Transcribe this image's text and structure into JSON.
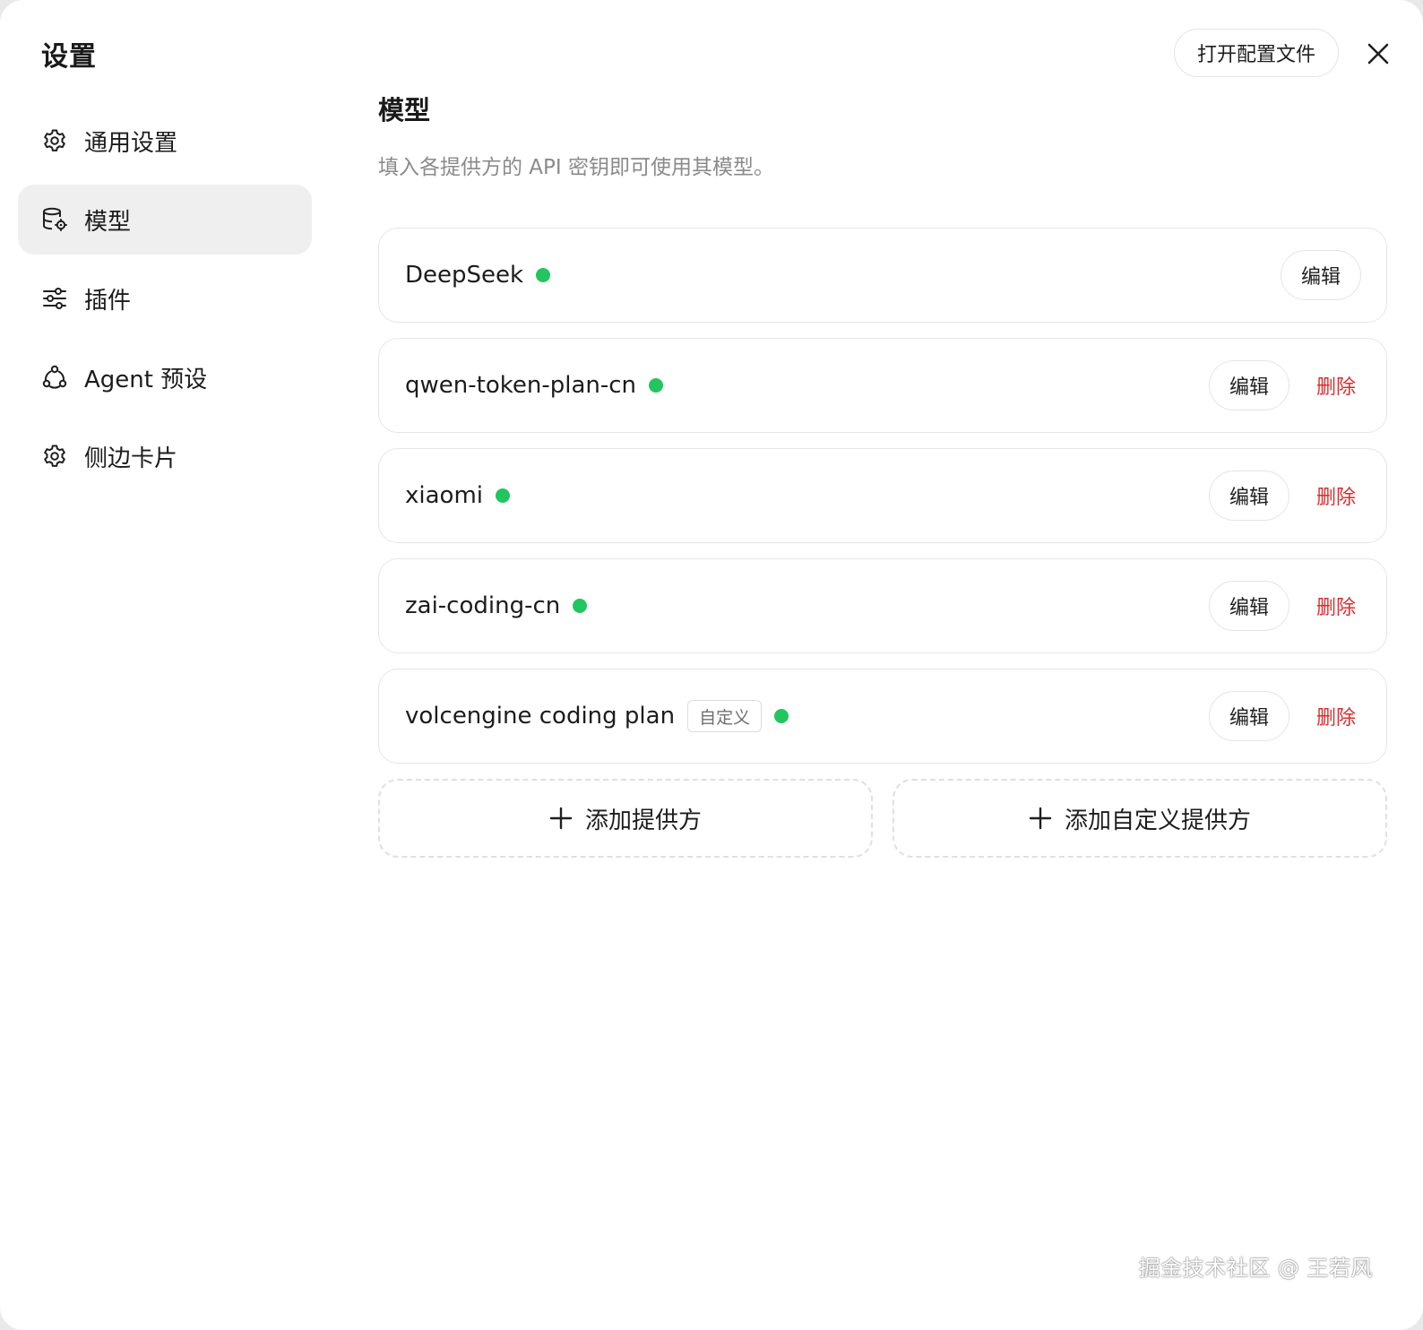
{
  "window": {
    "title": "设置",
    "open_config_label": "打开配置文件",
    "close_icon": "close-icon"
  },
  "sidebar": {
    "items": [
      {
        "label": "通用设置",
        "icon": "gear-icon",
        "active": false
      },
      {
        "label": "模型",
        "icon": "database-gear-icon",
        "active": true
      },
      {
        "label": "插件",
        "icon": "sliders-icon",
        "active": false
      },
      {
        "label": "Agent 预设",
        "icon": "agent-nodes-icon",
        "active": false
      },
      {
        "label": "侧边卡片",
        "icon": "gear-icon",
        "active": false
      }
    ]
  },
  "main": {
    "title": "模型",
    "description": "填入各提供方的 API 密钥即可使用其模型。",
    "providers": [
      {
        "name": "DeepSeek",
        "tag": "",
        "status": "active",
        "edit_label": "编辑",
        "delete_label": ""
      },
      {
        "name": "qwen-token-plan-cn",
        "tag": "",
        "status": "active",
        "edit_label": "编辑",
        "delete_label": "删除"
      },
      {
        "name": "xiaomi",
        "tag": "",
        "status": "active",
        "edit_label": "编辑",
        "delete_label": "删除"
      },
      {
        "name": "zai-coding-cn",
        "tag": "",
        "status": "active",
        "edit_label": "编辑",
        "delete_label": "删除"
      },
      {
        "name": "volcengine coding plan",
        "tag": "自定义",
        "status": "active",
        "edit_label": "编辑",
        "delete_label": "删除"
      }
    ],
    "add_provider_label": "添加提供方",
    "add_custom_provider_label": "添加自定义提供方"
  },
  "colors": {
    "status_active": "#22c55e",
    "delete": "#d92d2d",
    "active_nav_bg": "#efefef"
  },
  "watermark": "掘金技术社区 @ 王若风"
}
